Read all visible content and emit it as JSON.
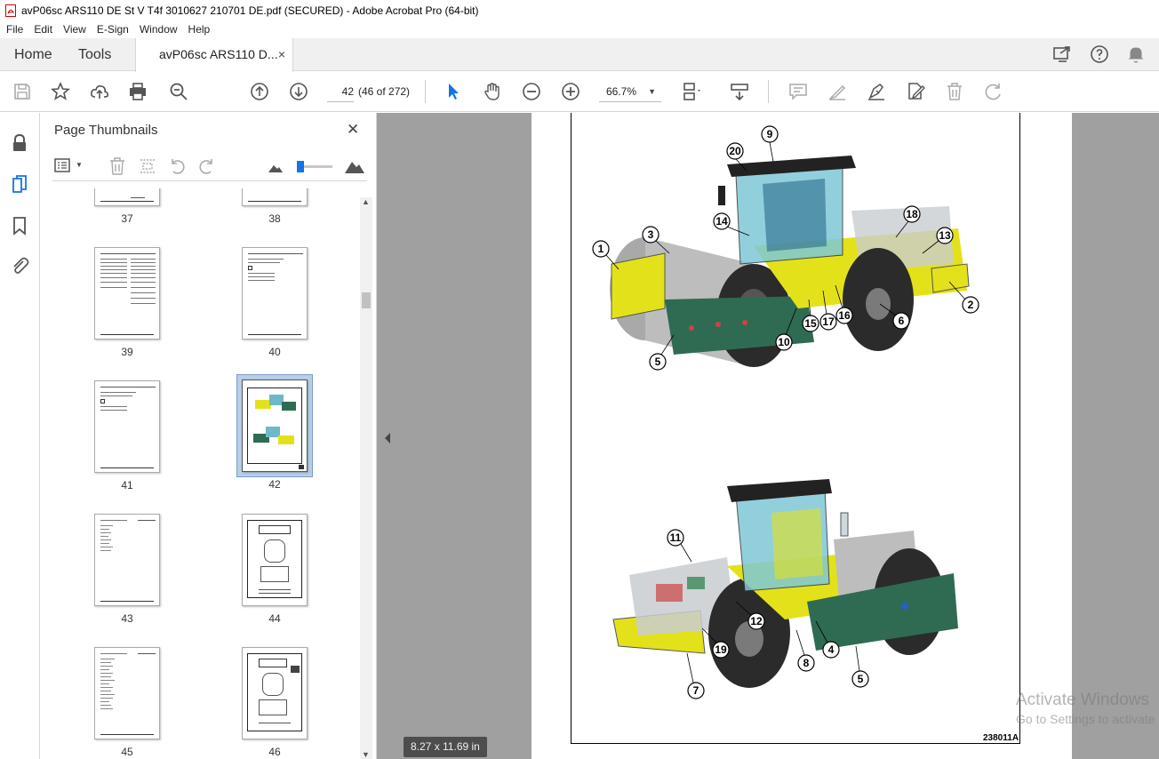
{
  "app": {
    "window_title": "avP06sc ARS110 DE St V T4f 3010627 210701 DE.pdf (SECURED) - Adobe Acrobat Pro (64-bit)"
  },
  "menu": [
    "File",
    "Edit",
    "View",
    "E-Sign",
    "Window",
    "Help"
  ],
  "tabs": {
    "home": "Home",
    "tools": "Tools",
    "document": "avP06sc ARS110 D...",
    "close": "×"
  },
  "toolbar": {
    "page_number": "42",
    "page_count": "(46 of 272)",
    "zoom": "66.7%"
  },
  "panel": {
    "title": "Page Thumbnails",
    "close": "✕"
  },
  "thumbnails": [
    {
      "label": "37"
    },
    {
      "label": "38"
    },
    {
      "label": "39"
    },
    {
      "label": "40"
    },
    {
      "label": "41"
    },
    {
      "label": "42",
      "selected": true
    },
    {
      "label": "43"
    },
    {
      "label": "44"
    },
    {
      "label": "45"
    },
    {
      "label": "46"
    }
  ],
  "document": {
    "figure_code": "238011A",
    "callouts_top": [
      "1",
      "2",
      "3",
      "5",
      "6",
      "9",
      "10",
      "13",
      "14",
      "15",
      "16",
      "17",
      "18",
      "20"
    ],
    "callouts_bottom": [
      "4",
      "5",
      "7",
      "8",
      "11",
      "12",
      "19"
    ],
    "page_size": "8.27 x 11.69 in"
  },
  "watermark": {
    "line1": "Activate Windows",
    "line2": "Go to Settings to activate"
  },
  "colors": {
    "machine_yellow": "#e3e21a",
    "machine_green": "#2f6b52",
    "viewer_bg": "#a0a0a0",
    "accent_blue": "#1473e6"
  }
}
